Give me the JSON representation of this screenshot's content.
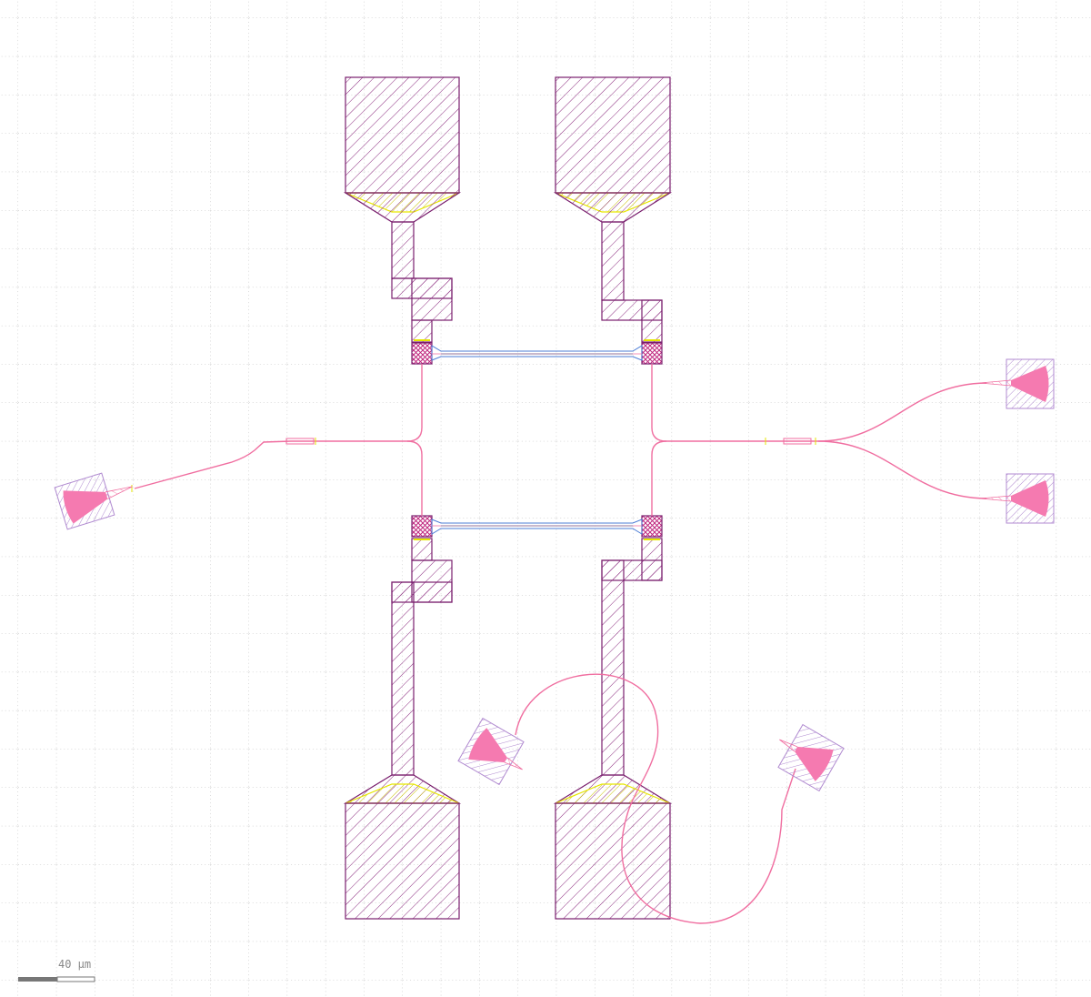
{
  "scale_bar": {
    "label": "40 µm"
  },
  "colors": {
    "background": "#ffffff",
    "grid_dot": "#b0b0b0",
    "metal_outline": "#7a1f6e",
    "metal_hatch": "#8a2a7e",
    "taper_outline": "#e6e600",
    "waveguide": "#f06ea0",
    "coupler_fill": "#f57ab0",
    "coupler_box": "#b08ad0",
    "via_fill": "#c0287f",
    "bridge_outer": "#4d7dd6",
    "bridge_inner": "#7fd6d6"
  }
}
